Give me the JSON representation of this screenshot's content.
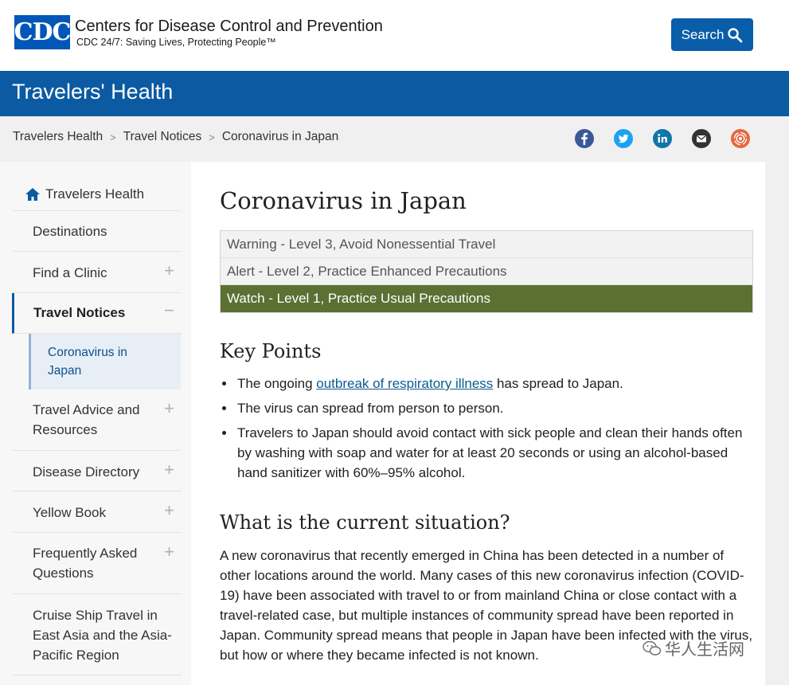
{
  "header": {
    "logo_text": "CDC",
    "org_name": "Centers for Disease Control and Prevention",
    "tagline": "CDC 24/7: Saving Lives, Protecting People™",
    "search_label": "Search"
  },
  "banner": {
    "title": "Travelers' Health"
  },
  "breadcrumb": {
    "items": [
      "Travelers Health",
      "Travel Notices",
      "Coronavirus in Japan"
    ],
    "separator": ">"
  },
  "social": [
    {
      "icon": "facebook-icon",
      "color": "#3b5998"
    },
    {
      "icon": "twitter-icon",
      "color": "#1da1f2"
    },
    {
      "icon": "linkedin-icon",
      "color": "#0e76a8"
    },
    {
      "icon": "email-icon",
      "color": "#333333"
    },
    {
      "icon": "syndicate-icon",
      "color": "#e8663d"
    }
  ],
  "sidebar": {
    "items": [
      {
        "label": "Travelers Health"
      },
      {
        "label": "Destinations"
      },
      {
        "label": "Find a Clinic",
        "expander": "+"
      },
      {
        "label": "Travel Notices",
        "expander": "−"
      },
      {
        "label": "Coronavirus in Japan"
      },
      {
        "label": "Travel Advice and Resources",
        "expander": "+"
      },
      {
        "label": "Disease Directory",
        "expander": "+"
      },
      {
        "label": "Yellow Book",
        "expander": "+"
      },
      {
        "label": "Frequently Asked Questions",
        "expander": "+"
      },
      {
        "label": "Cruise Ship Travel in East Asia and the Asia-Pacific Region"
      }
    ]
  },
  "main": {
    "title": "Coronavirus in Japan",
    "levels": [
      "Warning - Level 3, Avoid Nonessential Travel",
      "Alert - Level 2, Practice Enhanced Precautions",
      "Watch - Level 1, Practice Usual Precautions"
    ],
    "active_level_color": "#5b7032",
    "key_points_heading": "Key Points",
    "key_points": {
      "p1_before": "The ongoing ",
      "p1_link": "outbreak of respiratory illness",
      "p1_after": " has spread to Japan.",
      "p2": "The virus can spread from person to person.",
      "p3": "Travelers to Japan should avoid contact with sick people and clean their hands often by washing with soap and water for at least 20 seconds or using an alcohol-based hand sanitizer with 60%–95% alcohol."
    },
    "situation_heading": "What is the current situation?",
    "situation_text": "A new coronavirus that recently emerged in China has been detected in a number of other locations around the world. Many cases of this new coronavirus infection (COVID-19) have been associated with travel to or from mainland China or close contact with a travel-related case, but multiple instances of community spread have been reported in Japan. Community spread means that people in Japan have been infected with the virus, but how or where they became infected is not known."
  },
  "watermark": {
    "text": "华人生活网"
  },
  "colors": {
    "brand_blue": "#0b5aa2",
    "watch_green": "#5b7032",
    "link": "#0a5b8f"
  }
}
